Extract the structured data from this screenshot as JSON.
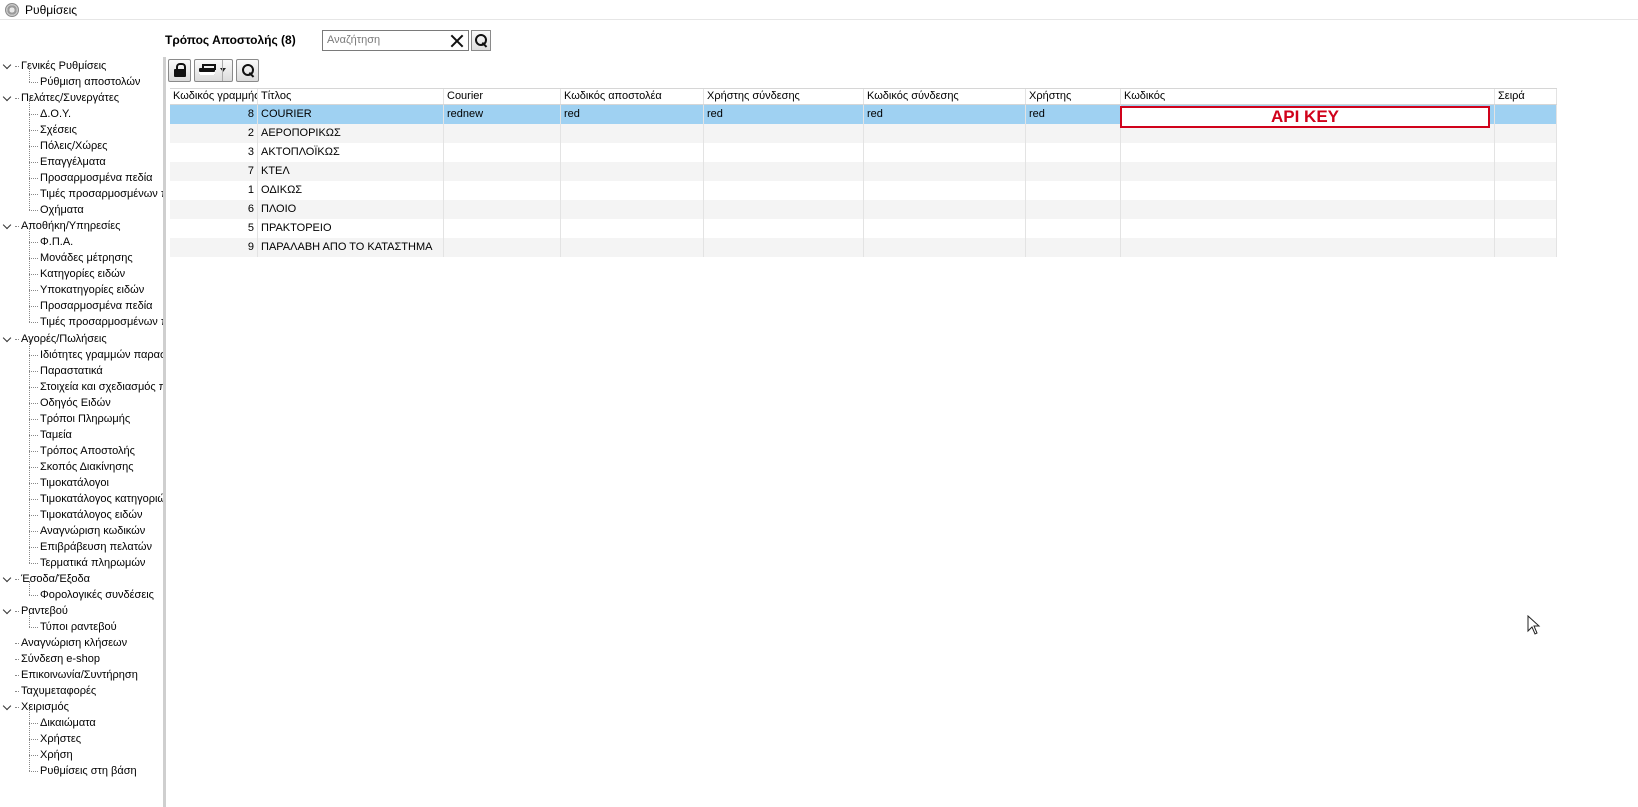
{
  "window": {
    "title": "Ρυθμίσεις"
  },
  "header": {
    "title": "Τρόπος Αποστολής (8)",
    "search_placeholder": "Αναζήτηση"
  },
  "tree": {
    "groups": [
      {
        "label": "Γενικές Ρυθμίσεις",
        "children": [
          "Ρύθμιση αποστολών"
        ]
      },
      {
        "label": "Πελάτες/Συνεργάτες",
        "children": [
          "Δ.Ο.Υ.",
          "Σχέσεις",
          "Πόλεις/Χώρες",
          "Επαγγέλματα",
          "Προσαρμοσμένα πεδία",
          "Τιμές προσαρμοσμένων π",
          "Οχήματα"
        ]
      },
      {
        "label": "Αποθήκη/Υπηρεσίες",
        "children": [
          "Φ.Π.Α.",
          "Μονάδες μέτρησης",
          "Κατηγορίες ειδών",
          "Υποκατηγορίες ειδών",
          "Προσαρμοσμένα πεδία",
          "Τιμές προσαρμοσμένων π"
        ]
      },
      {
        "label": "Αγορές/Πωλήσεις",
        "children": [
          "Ιδιότητες γραμμών παρασ",
          "Παραστατικά",
          "Στοιχεία και σχεδιασμός π",
          "Οδηγός Ειδών",
          "Τρόποι Πληρωμής",
          "Ταμεία",
          "Τρόπος Αποστολής",
          "Σκοπός Διακίνησης",
          "Τιμοκατάλογοι",
          "Τιμοκατάλογος κατηγοριώ",
          "Τιμοκατάλογος ειδών",
          "Αναγνώριση κωδικών",
          "Επιβράβευση πελατών",
          "Τερματικά πληρωμών"
        ]
      },
      {
        "label": "Έσοδα/Έξοδα",
        "children": [
          "Φορολογικές συνδέσεις"
        ]
      },
      {
        "label": "Ραντεβού",
        "children": [
          "Τύποι ραντεβού"
        ]
      },
      {
        "label": "Αναγνώριση κλήσεων",
        "children": []
      },
      {
        "label": "Σύνδεση e-shop",
        "children": []
      },
      {
        "label": "Επικοινωνία/Συντήρηση",
        "children": []
      },
      {
        "label": "Ταχυμεταφορές",
        "children": []
      },
      {
        "label": "Χειρισμός",
        "children": [
          "Δικαιώματα",
          "Χρήστες",
          "Χρήση",
          "Ρυθμίσεις στη βάση"
        ]
      }
    ]
  },
  "grid": {
    "columns": [
      "Κωδικός γραμμής",
      "Τίτλος",
      "Courier",
      "Κωδικός αποστολέα",
      "Χρήστης σύνδεσης",
      "Κωδικός σύνδεσης",
      "Χρήστης",
      "Κωδικός",
      "Σειρά"
    ],
    "rows": [
      {
        "code": "8",
        "title": "COURIER",
        "courier": "rednew",
        "sender_code": "red",
        "login_user": "red",
        "login_code": "red",
        "user": "red",
        "password": "",
        "order": ""
      },
      {
        "code": "2",
        "title": "ΑΕΡΟΠΟΡΙΚΩΣ",
        "courier": "",
        "sender_code": "",
        "login_user": "",
        "login_code": "",
        "user": "",
        "password": "",
        "order": ""
      },
      {
        "code": "3",
        "title": "ΑΚΤΟΠΛΟΪΚΩΣ",
        "courier": "",
        "sender_code": "",
        "login_user": "",
        "login_code": "",
        "user": "",
        "password": "",
        "order": ""
      },
      {
        "code": "7",
        "title": "ΚΤΕΛ",
        "courier": "",
        "sender_code": "",
        "login_user": "",
        "login_code": "",
        "user": "",
        "password": "",
        "order": ""
      },
      {
        "code": "1",
        "title": "ΟΔΙΚΩΣ",
        "courier": "",
        "sender_code": "",
        "login_user": "",
        "login_code": "",
        "user": "",
        "password": "",
        "order": ""
      },
      {
        "code": "6",
        "title": "ΠΛΟΙΟ",
        "courier": "",
        "sender_code": "",
        "login_user": "",
        "login_code": "",
        "user": "",
        "password": "",
        "order": ""
      },
      {
        "code": "5",
        "title": "ΠΡΑΚΤΟΡΕΙΟ",
        "courier": "",
        "sender_code": "",
        "login_user": "",
        "login_code": "",
        "user": "",
        "password": "",
        "order": ""
      },
      {
        "code": "9",
        "title": "ΠΑΡΑΛΑΒΗ ΑΠΟ ΤΟ ΚΑΤΑΣΤΗΜΑ",
        "courier": "",
        "sender_code": "",
        "login_user": "",
        "login_code": "",
        "user": "",
        "password": "",
        "order": ""
      }
    ],
    "selected_row": 0
  },
  "annotation": {
    "text": "API KEY",
    "color": "#d0021b"
  },
  "colors": {
    "selection": "#9fd1f2",
    "row_alt": "#f4f4f4"
  }
}
